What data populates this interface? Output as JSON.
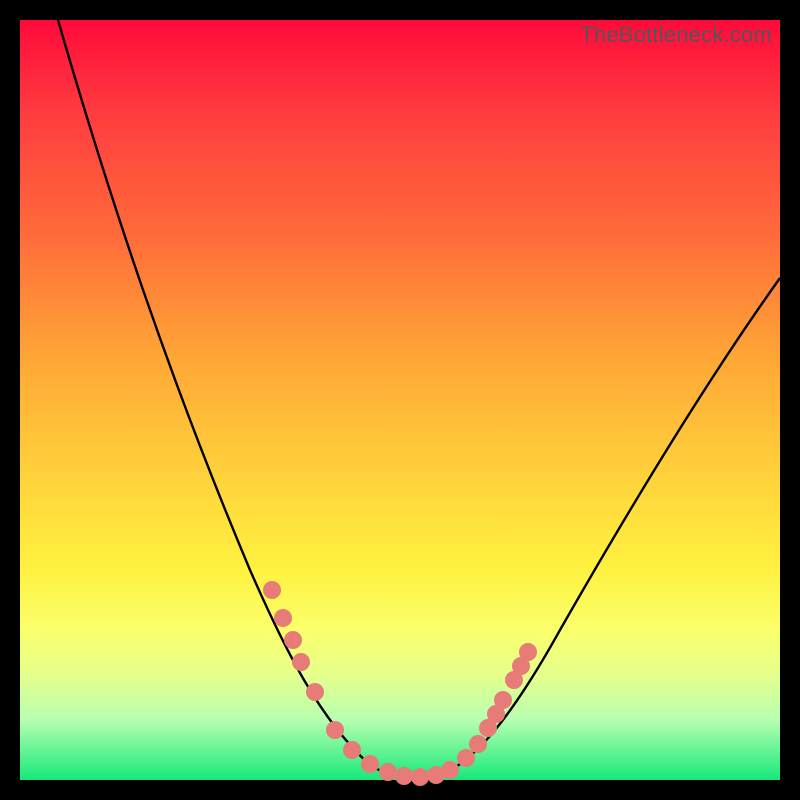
{
  "watermark": "TheBottleneck.com",
  "chart_data": {
    "type": "line",
    "title": "",
    "xlabel": "",
    "ylabel": "",
    "xlim": [
      0,
      100
    ],
    "ylim": [
      0,
      100
    ],
    "grid": false,
    "series": [
      {
        "name": "bottleneck-curve",
        "x": [
          5,
          10,
          15,
          20,
          25,
          30,
          33,
          36,
          39,
          42,
          45,
          48,
          50,
          52,
          55,
          58,
          62,
          66,
          70,
          75,
          80,
          85,
          90,
          95,
          100
        ],
        "y": [
          100,
          86,
          72,
          58,
          45,
          33,
          25,
          18,
          12,
          7,
          4,
          2,
          1,
          1,
          2,
          4,
          8,
          13,
          19,
          26,
          34,
          42,
          50,
          58,
          66
        ]
      }
    ],
    "markers": {
      "name": "highlight-dots",
      "x": [
        33,
        35,
        36,
        37,
        39,
        42,
        44,
        46,
        48,
        50,
        52,
        54,
        56,
        58,
        60,
        61,
        62
      ],
      "y": [
        25,
        21,
        19,
        16,
        12,
        7,
        5,
        3,
        2,
        1,
        1,
        2,
        3,
        4,
        6,
        8,
        10
      ],
      "color": "#e77b78",
      "radius": 9
    },
    "gradient_stops": [
      {
        "pos": 0,
        "color": "#ff0a3a"
      },
      {
        "pos": 28,
        "color": "#ff6a3a"
      },
      {
        "pos": 60,
        "color": "#ffd23b"
      },
      {
        "pos": 80,
        "color": "#fbff6a"
      },
      {
        "pos": 100,
        "color": "#16e97a"
      }
    ]
  }
}
